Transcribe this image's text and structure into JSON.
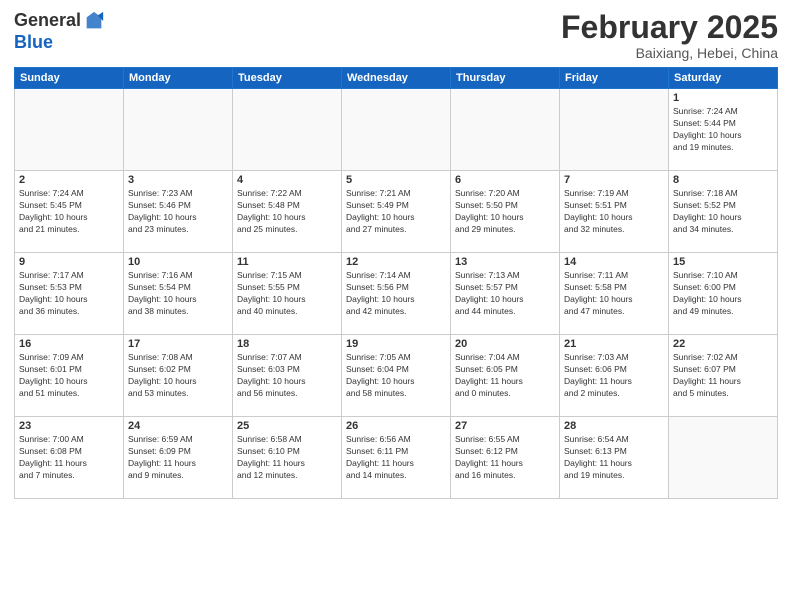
{
  "logo": {
    "general": "General",
    "blue": "Blue"
  },
  "header": {
    "month_year": "February 2025",
    "location": "Baixiang, Hebei, China"
  },
  "weekdays": [
    "Sunday",
    "Monday",
    "Tuesday",
    "Wednesday",
    "Thursday",
    "Friday",
    "Saturday"
  ],
  "weeks": [
    [
      {
        "day": "",
        "info": ""
      },
      {
        "day": "",
        "info": ""
      },
      {
        "day": "",
        "info": ""
      },
      {
        "day": "",
        "info": ""
      },
      {
        "day": "",
        "info": ""
      },
      {
        "day": "",
        "info": ""
      },
      {
        "day": "1",
        "info": "Sunrise: 7:24 AM\nSunset: 5:44 PM\nDaylight: 10 hours\nand 19 minutes."
      }
    ],
    [
      {
        "day": "2",
        "info": "Sunrise: 7:24 AM\nSunset: 5:45 PM\nDaylight: 10 hours\nand 21 minutes."
      },
      {
        "day": "3",
        "info": "Sunrise: 7:23 AM\nSunset: 5:46 PM\nDaylight: 10 hours\nand 23 minutes."
      },
      {
        "day": "4",
        "info": "Sunrise: 7:22 AM\nSunset: 5:48 PM\nDaylight: 10 hours\nand 25 minutes."
      },
      {
        "day": "5",
        "info": "Sunrise: 7:21 AM\nSunset: 5:49 PM\nDaylight: 10 hours\nand 27 minutes."
      },
      {
        "day": "6",
        "info": "Sunrise: 7:20 AM\nSunset: 5:50 PM\nDaylight: 10 hours\nand 29 minutes."
      },
      {
        "day": "7",
        "info": "Sunrise: 7:19 AM\nSunset: 5:51 PM\nDaylight: 10 hours\nand 32 minutes."
      },
      {
        "day": "8",
        "info": "Sunrise: 7:18 AM\nSunset: 5:52 PM\nDaylight: 10 hours\nand 34 minutes."
      }
    ],
    [
      {
        "day": "9",
        "info": "Sunrise: 7:17 AM\nSunset: 5:53 PM\nDaylight: 10 hours\nand 36 minutes."
      },
      {
        "day": "10",
        "info": "Sunrise: 7:16 AM\nSunset: 5:54 PM\nDaylight: 10 hours\nand 38 minutes."
      },
      {
        "day": "11",
        "info": "Sunrise: 7:15 AM\nSunset: 5:55 PM\nDaylight: 10 hours\nand 40 minutes."
      },
      {
        "day": "12",
        "info": "Sunrise: 7:14 AM\nSunset: 5:56 PM\nDaylight: 10 hours\nand 42 minutes."
      },
      {
        "day": "13",
        "info": "Sunrise: 7:13 AM\nSunset: 5:57 PM\nDaylight: 10 hours\nand 44 minutes."
      },
      {
        "day": "14",
        "info": "Sunrise: 7:11 AM\nSunset: 5:58 PM\nDaylight: 10 hours\nand 47 minutes."
      },
      {
        "day": "15",
        "info": "Sunrise: 7:10 AM\nSunset: 6:00 PM\nDaylight: 10 hours\nand 49 minutes."
      }
    ],
    [
      {
        "day": "16",
        "info": "Sunrise: 7:09 AM\nSunset: 6:01 PM\nDaylight: 10 hours\nand 51 minutes."
      },
      {
        "day": "17",
        "info": "Sunrise: 7:08 AM\nSunset: 6:02 PM\nDaylight: 10 hours\nand 53 minutes."
      },
      {
        "day": "18",
        "info": "Sunrise: 7:07 AM\nSunset: 6:03 PM\nDaylight: 10 hours\nand 56 minutes."
      },
      {
        "day": "19",
        "info": "Sunrise: 7:05 AM\nSunset: 6:04 PM\nDaylight: 10 hours\nand 58 minutes."
      },
      {
        "day": "20",
        "info": "Sunrise: 7:04 AM\nSunset: 6:05 PM\nDaylight: 11 hours\nand 0 minutes."
      },
      {
        "day": "21",
        "info": "Sunrise: 7:03 AM\nSunset: 6:06 PM\nDaylight: 11 hours\nand 2 minutes."
      },
      {
        "day": "22",
        "info": "Sunrise: 7:02 AM\nSunset: 6:07 PM\nDaylight: 11 hours\nand 5 minutes."
      }
    ],
    [
      {
        "day": "23",
        "info": "Sunrise: 7:00 AM\nSunset: 6:08 PM\nDaylight: 11 hours\nand 7 minutes."
      },
      {
        "day": "24",
        "info": "Sunrise: 6:59 AM\nSunset: 6:09 PM\nDaylight: 11 hours\nand 9 minutes."
      },
      {
        "day": "25",
        "info": "Sunrise: 6:58 AM\nSunset: 6:10 PM\nDaylight: 11 hours\nand 12 minutes."
      },
      {
        "day": "26",
        "info": "Sunrise: 6:56 AM\nSunset: 6:11 PM\nDaylight: 11 hours\nand 14 minutes."
      },
      {
        "day": "27",
        "info": "Sunrise: 6:55 AM\nSunset: 6:12 PM\nDaylight: 11 hours\nand 16 minutes."
      },
      {
        "day": "28",
        "info": "Sunrise: 6:54 AM\nSunset: 6:13 PM\nDaylight: 11 hours\nand 19 minutes."
      },
      {
        "day": "",
        "info": ""
      }
    ]
  ]
}
